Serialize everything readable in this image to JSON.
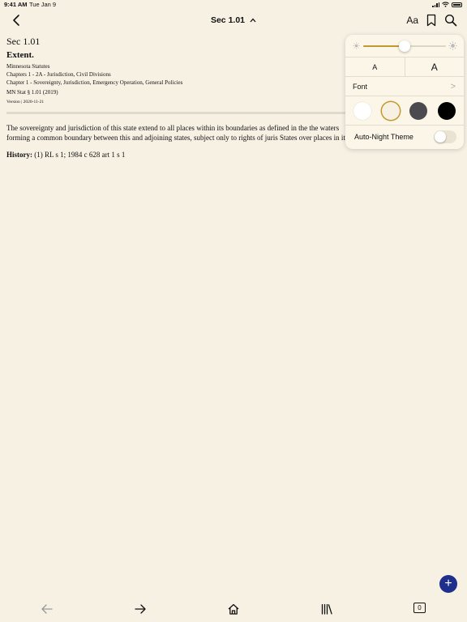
{
  "status_bar": {
    "time": "9:41 AM",
    "date": "Tue Jan 9"
  },
  "nav": {
    "title": "Sec 1.01",
    "title_chevron": "^",
    "font_button": "Aa"
  },
  "document": {
    "section": "Sec 1.01",
    "heading": "Extent.",
    "meta_lines": [
      "Minnesota Statutes",
      "Chapters 1 - 2A - Jurisdiction, Civil Divisions",
      "Chapter 1 - Sovereignty, Jurisdiction, Emergency Operation, General Policies",
      "MN Stat § 1.01 (2019)"
    ],
    "version": "Version | 2020-11-21",
    "body": "The sovereignty and jurisdiction of this state extend to all places within its boundaries as defined in the the waters forming a common boundary between this and adjoining states, subject only to rights of juris States over places in it.",
    "history_label": "History:",
    "history_text": " (1) RL s 1; 1984 c 628 art 1 s 1"
  },
  "popover": {
    "brightness": 0.5,
    "size_small": "A",
    "size_large": "A",
    "font_label": "Font",
    "font_chevron": ">",
    "themes": [
      {
        "name": "white",
        "color": "#ffffff",
        "selected": false
      },
      {
        "name": "sepia",
        "color": "#f7f1e4",
        "selected": true
      },
      {
        "name": "gray",
        "color": "#4a4a4f",
        "selected": false
      },
      {
        "name": "black",
        "color": "#000000",
        "selected": false
      }
    ],
    "auto_night_label": "Auto-Night Theme",
    "auto_night_on": false
  },
  "fab": {
    "label": "+"
  },
  "toolbar": {
    "tab_count": "0"
  },
  "colors": {
    "background": "#f7f1e4",
    "accent": "#c39a30",
    "fab": "#1f2f8c"
  }
}
